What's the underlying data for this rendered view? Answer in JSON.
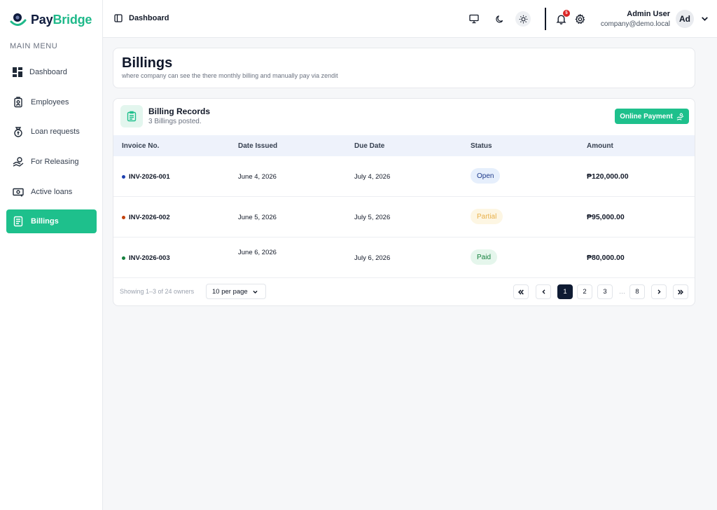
{
  "brand": {
    "name_part1": "Pay",
    "name_part2": "Bridge"
  },
  "sidebar": {
    "section_label": "MAIN MENU",
    "items": [
      {
        "label": "Dashboard",
        "icon": "dashboard-grid-icon"
      },
      {
        "label": "Employees",
        "icon": "id-badge-icon"
      },
      {
        "label": "Loan requests",
        "icon": "money-bag-icon"
      },
      {
        "label": "For Releasing",
        "icon": "hand-coin-icon"
      },
      {
        "label": "Active loans",
        "icon": "cash-icon"
      },
      {
        "label": "Billings",
        "icon": "document-icon",
        "active": true
      }
    ]
  },
  "topbar": {
    "title": "Dashboard",
    "notification_count": "5",
    "user_name": "Admin User",
    "user_email": "company@demo.local",
    "avatar_initials": "Ad"
  },
  "page": {
    "title": "Billings",
    "subtitle": "where company can see the there monthly billing and manually pay via zendit"
  },
  "records": {
    "title": "Billing Records",
    "count_text": "3 Billings posted.",
    "online_payment_label": "Online Payment",
    "columns": [
      "Invoice No.",
      "Date Issued",
      "Due Date",
      "Status",
      "Amount"
    ],
    "rows": [
      {
        "invoice": "INV-2026-001",
        "issued": "June 4, 2026",
        "due": "July 4, 2026",
        "status": "Open",
        "amount": "₱120,000.00",
        "dot_color": "#1e40af",
        "status_bg": "#e6effc",
        "status_fg": "#1e3a8a"
      },
      {
        "invoice": "INV-2026-002",
        "issued": "June 5, 2026",
        "due": "July 5, 2026",
        "status": "Partial",
        "amount": "₱95,000.00",
        "dot_color": "#c2410c",
        "status_bg": "#fdf6e3",
        "status_fg": "#e8b04a"
      },
      {
        "invoice": "INV-2026-003",
        "issued": "June 6, 2026",
        "due": "July 6, 2026",
        "status": "Paid",
        "amount": "₱80,000.00",
        "dot_color": "#15803d",
        "status_bg": "#e5f6ec",
        "status_fg": "#15803d"
      }
    ],
    "footer_info": "Showing 1–3 of 24 owners",
    "per_page": "10 per page",
    "pages": [
      "1",
      "2",
      "3",
      "8"
    ],
    "current_page": "1",
    "ellipsis": "…"
  },
  "colors": {
    "accent": "#1ec08c",
    "navy": "#0f1b33"
  }
}
